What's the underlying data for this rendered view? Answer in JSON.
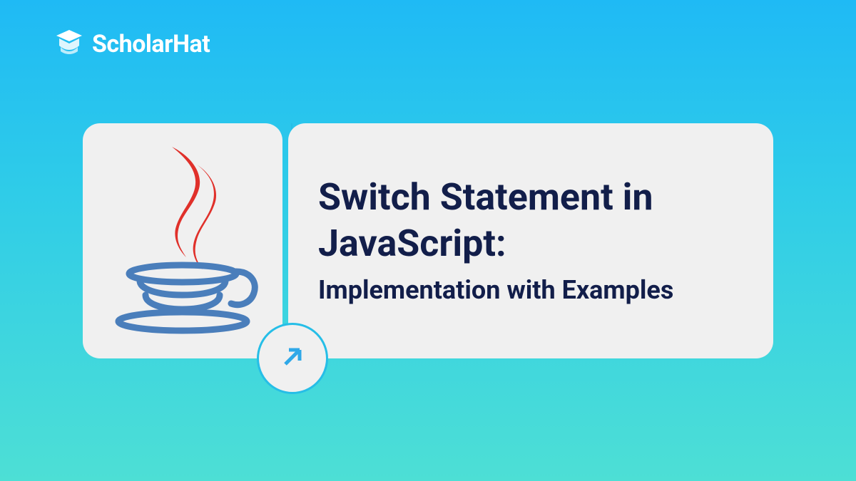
{
  "brand": {
    "name": "ScholarHat"
  },
  "content": {
    "title": "Switch Statement in JavaScript:",
    "subtitle": "Implementation with Examples"
  },
  "colors": {
    "text_dark": "#121E4A",
    "card_bg": "#F0F0F0",
    "accent": "#26BEE7",
    "white": "#ffffff",
    "java_blue": "#4A7EBB",
    "java_red": "#E0302A"
  }
}
